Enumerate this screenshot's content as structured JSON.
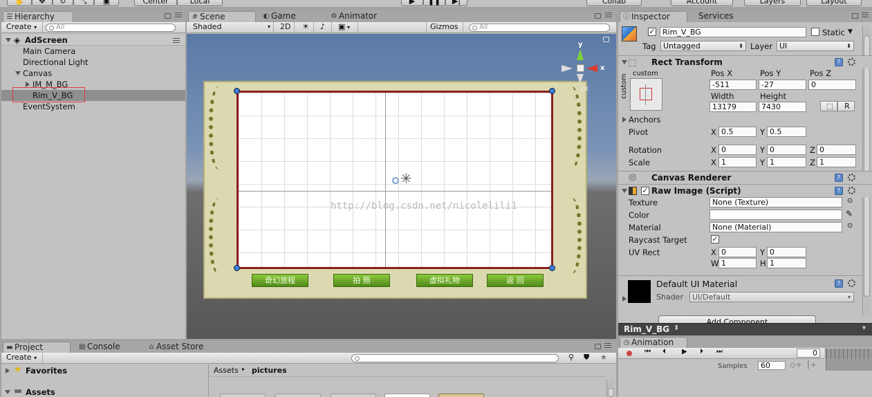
{
  "toolbar": {
    "center_label": "Center",
    "local_label": "Local",
    "collab_label": "Collab",
    "account_label": "Account",
    "layers_label": "Layers",
    "layout_label": "Layout"
  },
  "hierarchy": {
    "tab": "Hierarchy",
    "create": "Create",
    "search_placeholder": "All",
    "scene": "AdScreen",
    "items": [
      "Main Camera",
      "Directional Light",
      "Canvas",
      "IM_M_BG",
      "Rim_V_BG",
      "EventSystem"
    ]
  },
  "scene": {
    "tabs": [
      "Scene",
      "Game",
      "Animator"
    ],
    "shaded": "Shaded",
    "mode2d": "2D",
    "gizmos": "Gizmos",
    "search_placeholder": "All",
    "gizmo_y": "y",
    "gizmo_x": "x",
    "back_label": "ck",
    "watermark": "http://blog.csdn.net/nicolelili1",
    "buttons": [
      "奇幻旅程",
      "拍    照",
      "虚拟礼物",
      "返    回"
    ]
  },
  "inspector": {
    "tabs": [
      "Inspector",
      "Services"
    ],
    "object_name": "Rim_V_BG",
    "static_label": "Static",
    "tag_label": "Tag",
    "tag_value": "Untagged",
    "layer_label": "Layer",
    "layer_value": "UI",
    "rect_transform": {
      "title": "Rect Transform",
      "anchor_preset": "custom",
      "anchor_side": "custom",
      "pos_x_label": "Pos X",
      "pos_x": "-511",
      "pos_y_label": "Pos Y",
      "pos_y": "-27",
      "pos_z_label": "Pos Z",
      "pos_z": "0",
      "width_label": "Width",
      "width": "13179",
      "height_label": "Height",
      "height": "7430",
      "r_label": "R",
      "anchors_label": "Anchors",
      "pivot_label": "Pivot",
      "pivot_x": "0.5",
      "pivot_y": "0.5",
      "rotation_label": "Rotation",
      "rot_x": "0",
      "rot_y": "0",
      "rot_z": "0",
      "scale_label": "Scale",
      "scale_x": "1",
      "scale_y": "1",
      "scale_z": "1",
      "x": "X",
      "y": "Y",
      "z": "Z"
    },
    "canvas_renderer": "Canvas Renderer",
    "raw_image": {
      "title": "Raw Image (Script)",
      "texture_label": "Texture",
      "texture": "None (Texture)",
      "color_label": "Color",
      "material_label": "Material",
      "material": "None (Material)",
      "raycast_label": "Raycast Target",
      "uvrect_label": "UV Rect",
      "uv_x": "0",
      "uv_y": "0",
      "uv_w": "1",
      "uv_h": "1",
      "w": "W",
      "h": "H"
    },
    "material_block": {
      "name": "Default UI Material",
      "shader_label": "Shader",
      "shader": "UI/Default"
    },
    "add_component": "Add Component",
    "preview_name": "Rim_V_BG"
  },
  "project": {
    "tabs": [
      "Project",
      "Console",
      "Asset Store"
    ],
    "create": "Create",
    "favorites": "Favorites",
    "assets": "Assets",
    "breadcrumb": [
      "Assets",
      "pictures"
    ]
  },
  "animation": {
    "tab": "Animation",
    "frame": "0",
    "samples_label": "Samples",
    "samples": "60"
  }
}
